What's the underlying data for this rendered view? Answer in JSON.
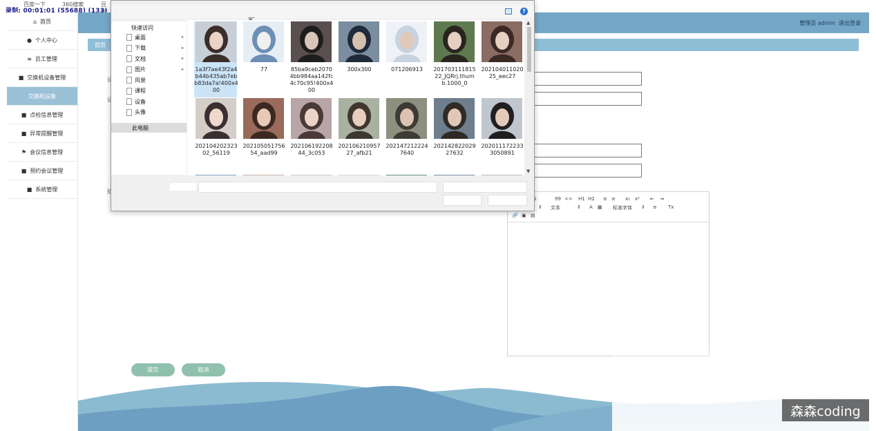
{
  "topbar": {
    "bookmarks": [
      "百度一下",
      "360搜索",
      "豆瓣"
    ],
    "recording": "录制: 00:01:01 (55688) (133)"
  },
  "sidebar": {
    "items": [
      {
        "label": "首页",
        "icon": "home-icon",
        "glyph": "⌂"
      },
      {
        "label": "个人中心",
        "icon": "user-icon",
        "glyph": "●"
      },
      {
        "label": "员工管理",
        "icon": "list-icon",
        "glyph": "≡"
      },
      {
        "label": "交换机设备管理",
        "icon": "briefcase-icon",
        "glyph": "■"
      },
      {
        "label": "交换机设备",
        "icon": "",
        "glyph": ""
      },
      {
        "label": "点检信息管理",
        "icon": "video-icon",
        "glyph": "■"
      },
      {
        "label": "异常提醒管理",
        "icon": "grid-icon",
        "glyph": "■"
      },
      {
        "label": "会议信息管理",
        "icon": "flag-icon",
        "glyph": "⚑"
      },
      {
        "label": "预约会议管理",
        "icon": "hand-icon",
        "glyph": "■"
      },
      {
        "label": "系统管理",
        "icon": "grid-icon",
        "glyph": "■"
      }
    ]
  },
  "header": {
    "user": "管理员 admin",
    "logout": "退出登录"
  },
  "breadcrumb": {
    "home": "首页"
  },
  "form": {
    "labels_partial": [
      "设",
      "设",
      "描"
    ],
    "submit": "提交",
    "cancel": "取消"
  },
  "editor": {
    "toolbar_text": "文本",
    "font_text": "标准字体",
    "glyphs": [
      "B",
      "G",
      "99",
      "<>",
      "H1",
      "H2",
      "≡",
      "≡",
      "x₁",
      "x²",
      "⇤",
      "⇥",
      "A",
      "▦",
      "≡",
      "Tx"
    ]
  },
  "watermark": "森森coding",
  "dialog": {
    "quick_access": "快速访问",
    "nav": [
      {
        "label": "桌面",
        "pinned": true
      },
      {
        "label": "下载",
        "pinned": true
      },
      {
        "label": "文档",
        "pinned": true
      },
      {
        "label": "图片",
        "pinned": true
      },
      {
        "label": "风景",
        "pinned": false
      },
      {
        "label": "课程",
        "pinned": false
      },
      {
        "label": "设备",
        "pinned": false
      },
      {
        "label": "头像",
        "pinned": false
      }
    ],
    "this_pc": "此电脑",
    "help": "?",
    "files": [
      {
        "name": "1a3f7ae43f2a4b44b435ab7ebb83da7a!400x400",
        "selected": true
      },
      {
        "name": "77"
      },
      {
        "name": "85ba9ceb20704bb984aa142fc4c70c95!400x400"
      },
      {
        "name": "300x300"
      },
      {
        "name": "071206913"
      },
      {
        "name": "20170311181522_JQRrj.thumb.1000_0"
      },
      {
        "name": "20210401102025_eec27"
      },
      {
        "name": "20210420232302_56119"
      },
      {
        "name": "20210505175654_aad99"
      },
      {
        "name": "20210619220844_3c053"
      },
      {
        "name": "20210621095727_afb21"
      },
      {
        "name": "2021472122247640"
      },
      {
        "name": "20214282202927632"
      },
      {
        "name": "2020111722333050891"
      },
      {
        "name": ""
      },
      {
        "name": ""
      },
      {
        "name": ""
      },
      {
        "name": ""
      },
      {
        "name": ""
      },
      {
        "name": ""
      },
      {
        "name": ""
      }
    ]
  }
}
